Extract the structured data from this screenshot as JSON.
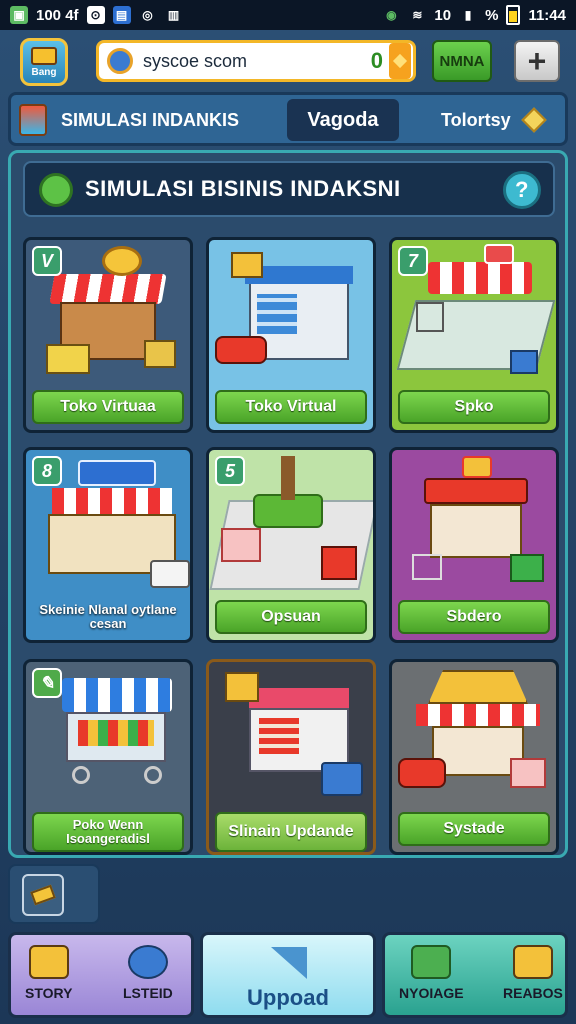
{
  "status_bar": {
    "left_text": "100 4f",
    "right_text": "10",
    "battery_percent": "%",
    "time": "11:44"
  },
  "topbar": {
    "logo_label": "Bang",
    "search_placeholder": "syscoe scom",
    "coin_count": "0",
    "nmna_label": "NMNA",
    "plus_label": "+"
  },
  "tabs": [
    {
      "label": "SIMULASI INDANKIS"
    },
    {
      "label": "Vagoda"
    },
    {
      "label": "Tolortsy"
    }
  ],
  "panel": {
    "title": "SIMULASI BISINIS INDAKSNI",
    "help_label": "?"
  },
  "cards": [
    {
      "badge": "V",
      "label": "Toko Virtuaa"
    },
    {
      "badge": "",
      "label": "Toko Virtual"
    },
    {
      "badge": "7",
      "label": "Spko"
    },
    {
      "badge": "8",
      "label": "Skeinie Nlanal oytlane cesan"
    },
    {
      "badge": "5",
      "label": "Opsuan"
    },
    {
      "badge": "",
      "label": "Sbdero"
    },
    {
      "badge": "",
      "label": "Poko Wenn Isoangeradisl"
    },
    {
      "badge": "",
      "label": "Slinain Updande"
    },
    {
      "badge": "",
      "label": "Systade"
    }
  ],
  "bottom_nav": {
    "left_a": "STORY",
    "left_b": "LSTEID",
    "center": "Uppoad",
    "right_a": "NYOIAGE",
    "right_b": "REABOS"
  },
  "colors": {
    "background": "#2b4f74",
    "panel_border": "#39a9b2",
    "label_green": "#5cb836",
    "accent_gold": "#f3b728"
  }
}
